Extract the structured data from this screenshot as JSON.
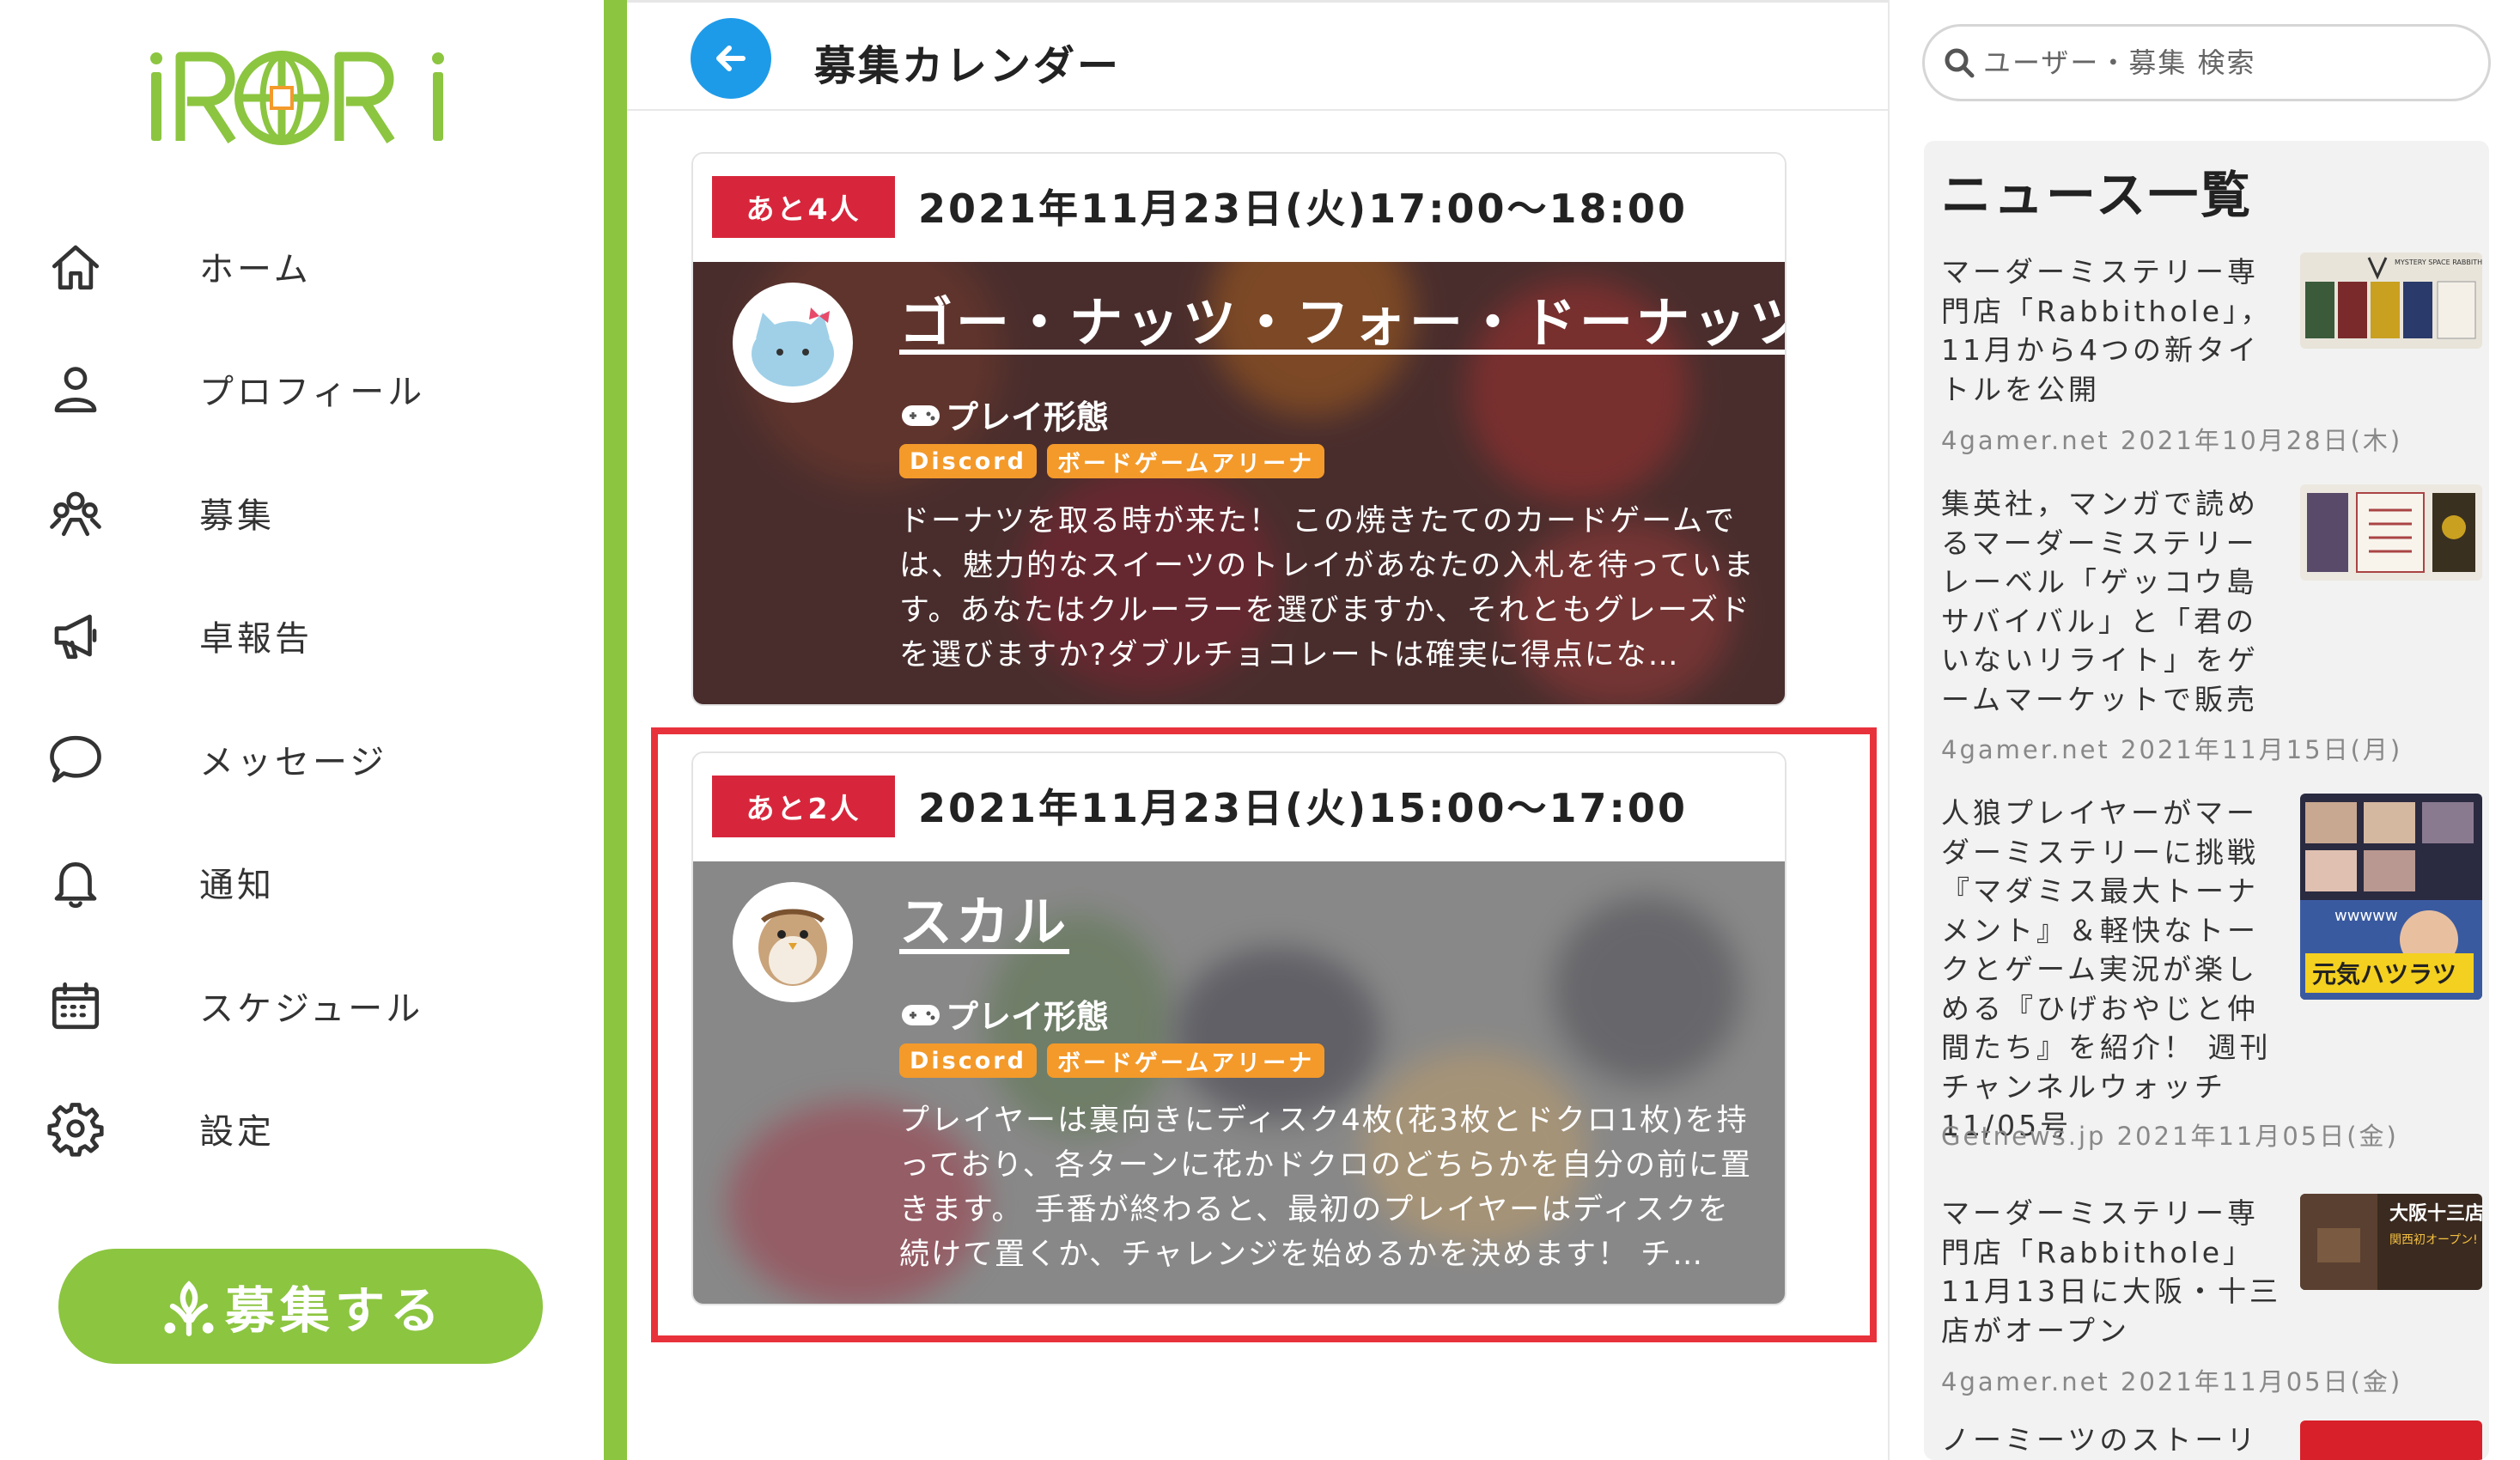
{
  "brand": {
    "logo_text": "iRORi",
    "logo_color": "#8cc540"
  },
  "sidebar": {
    "items": [
      {
        "label": "ホーム",
        "icon": "home-icon"
      },
      {
        "label": "プロフィール",
        "icon": "user-icon"
      },
      {
        "label": "募集",
        "icon": "recruit-icon"
      },
      {
        "label": "卓報告",
        "icon": "megaphone-icon"
      },
      {
        "label": "メッセージ",
        "icon": "chat-icon"
      },
      {
        "label": "通知",
        "icon": "bell-icon"
      },
      {
        "label": "スケジュール",
        "icon": "calendar-icon"
      },
      {
        "label": "設定",
        "icon": "gear-icon"
      }
    ],
    "recruit_button": "募集する"
  },
  "header": {
    "title": "募集カレンダー",
    "back_icon": "arrow-left-icon"
  },
  "events": [
    {
      "badge": "あと4人",
      "date": "2021年11月23日(火)17:00〜18:00",
      "title": "ゴー・ナッツ・フォー・ドーナッツ",
      "play_label": "プレイ形態",
      "tags": [
        "Discord",
        "ボードゲームアリーナ"
      ],
      "description": "ドーナツを取る時が来た！ この焼きたてのカードゲームでは、魅力的なスイーツのトレイがあなたの入札を待っています。あなたはクルーラーを選びますか、それともグレーズドを選びますか?ダブルチョコレートは確実に得点にな…"
    },
    {
      "badge": "あと2人",
      "date": "2021年11月23日(火)15:00〜17:00",
      "title": "スカル",
      "play_label": "プレイ形態",
      "tags": [
        "Discord",
        "ボードゲームアリーナ"
      ],
      "description": "プレイヤーは裏向きにディスク4枚(花3枚とドクロ1枚)を持っており、各ターンに花かドクロのどちらかを自分の前に置きます。 手番が終わると、最初のプレイヤーはディスクを続けて置くか、チャレンジを始めるかを決めます！ チ…"
    }
  ],
  "annotation": {
    "marker": "2",
    "color": "#e8323b"
  },
  "search": {
    "placeholder": "ユーザー・募集 検索"
  },
  "news": {
    "title": "ニュース一覧",
    "items": [
      {
        "text": "マーダーミステリー専門店「Rabbithole」，11月から4つの新タイトルを公開",
        "meta": "4gamer.net 2021年10月28日(木)"
      },
      {
        "text": "集英社，マンガで読めるマーダーミステリーレーベル「ゲッコウ島サバイバル」と「君のいないリライト」をゲームマーケットで販売",
        "meta": "4gamer.net 2021年11月15日(月)"
      },
      {
        "text": "人狼プレイヤーがマーダーミステリーに挑戦『マダミス最大トーナメント』＆軽快なトークとゲーム実況が楽しめる『ひげおやじと仲間たち』を紹介！ 週刊チャンネルウォッチ 11/05号",
        "meta": "Getnews.jp 2021年11月05日(金)"
      },
      {
        "text": "マーダーミステリー専門店「Rabbithole」11月13日に大阪・十三店がオープン",
        "meta": "4gamer.net 2021年11月05日(金)"
      },
      {
        "text": "ノーミーツのストーリー",
        "meta": ""
      }
    ],
    "thumb_texts": [
      "MYSTERY SPACE RABBITHOLE",
      "wwwww",
      "元気ハツラツ",
      "大阪十三店",
      "関西初オープン!"
    ]
  },
  "colors": {
    "accent_green": "#8cc540",
    "back_blue": "#1e9be8",
    "badge_red": "#d7263b",
    "tag_orange": "#f39a2b"
  }
}
